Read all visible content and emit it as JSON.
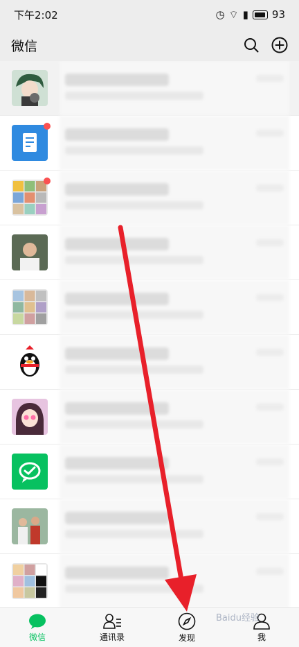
{
  "status_bar": {
    "time": "下午2:02",
    "battery": "93"
  },
  "header": {
    "title": "微信",
    "search_icon": "search-icon",
    "add_icon": "plus-circle-icon"
  },
  "chats": [
    {
      "pinned": true,
      "unread": false,
      "avatar": "anime-boy-avatar"
    },
    {
      "pinned": false,
      "unread": true,
      "avatar": "document-icon-avatar"
    },
    {
      "pinned": false,
      "unread": true,
      "avatar": "group-grid-avatar"
    },
    {
      "pinned": false,
      "unread": false,
      "avatar": "person-photo-avatar"
    },
    {
      "pinned": false,
      "unread": false,
      "avatar": "group-grid-avatar"
    },
    {
      "pinned": false,
      "unread": false,
      "avatar": "qq-penguin-avatar"
    },
    {
      "pinned": false,
      "unread": false,
      "avatar": "anime-girl-avatar"
    },
    {
      "pinned": false,
      "unread": false,
      "avatar": "wechat-pay-avatar"
    },
    {
      "pinned": false,
      "unread": false,
      "avatar": "group-photo-avatar"
    },
    {
      "pinned": false,
      "unread": false,
      "avatar": "group-grid-avatar"
    }
  ],
  "tabs": [
    {
      "label": "微信",
      "icon": "chat-bubble-icon",
      "active": true
    },
    {
      "label": "通讯录",
      "icon": "contacts-icon",
      "active": false
    },
    {
      "label": "发现",
      "icon": "compass-icon",
      "active": false
    },
    {
      "label": "我",
      "icon": "person-icon",
      "active": false
    }
  ],
  "colors": {
    "accent": "#07c160",
    "arrow": "#e8202a",
    "unread": "#fa5151"
  },
  "watermark": "Baidu经验"
}
